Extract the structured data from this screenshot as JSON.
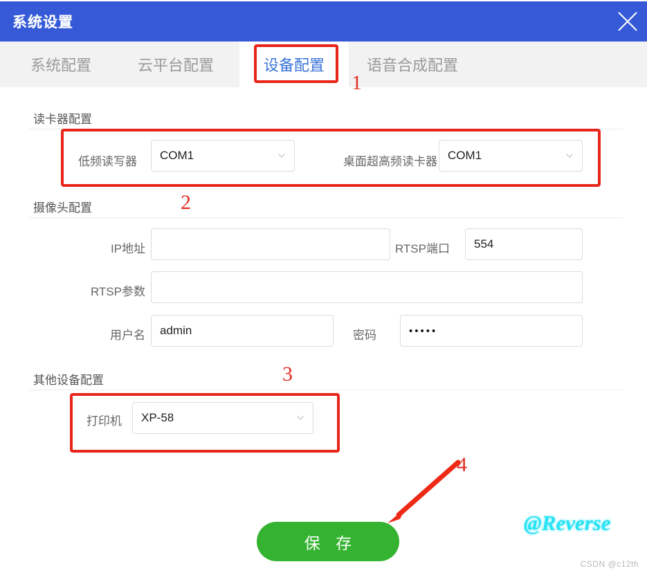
{
  "window": {
    "title": "系统设置",
    "close_icon": "close-icon",
    "accent_color": "#3659d8"
  },
  "tabs": [
    {
      "label": "系统配置",
      "active": false
    },
    {
      "label": "云平台配置",
      "active": false
    },
    {
      "label": "设备配置",
      "active": true
    },
    {
      "label": "语音合成配置",
      "active": false
    }
  ],
  "sections": [
    {
      "heading": "读卡器配置",
      "fields": [
        {
          "label": "低频读写器",
          "type": "select",
          "value": "COM1",
          "icon": "chevron-down-icon"
        },
        {
          "label": "桌面超高频读卡器",
          "type": "select",
          "value": "COM1",
          "icon": "chevron-down-icon"
        }
      ]
    },
    {
      "heading": "摄像头配置",
      "fields": [
        {
          "label": "IP地址",
          "type": "text",
          "value": ""
        },
        {
          "label": "RTSP端口",
          "type": "text",
          "value": "554"
        },
        {
          "label": "RTSP参数",
          "type": "text",
          "value": ""
        },
        {
          "label": "用户名",
          "type": "text",
          "value": "admin"
        },
        {
          "label": "密码",
          "type": "password",
          "value": "•••••"
        }
      ]
    },
    {
      "heading": "其他设备配置",
      "fields": [
        {
          "label": "打印机",
          "type": "select",
          "value": "XP-58",
          "icon": "chevron-down-icon"
        }
      ]
    }
  ],
  "actions": {
    "save_label": "保 存",
    "save_color": "#34b330"
  },
  "annotations": {
    "color": "#e8251a",
    "markers": [
      "1",
      "2",
      "3",
      "4"
    ],
    "arrow_icon": "arrow-down-left-icon"
  },
  "watermarks": {
    "author": "@Reverse",
    "site": "CSDN @c12th"
  }
}
